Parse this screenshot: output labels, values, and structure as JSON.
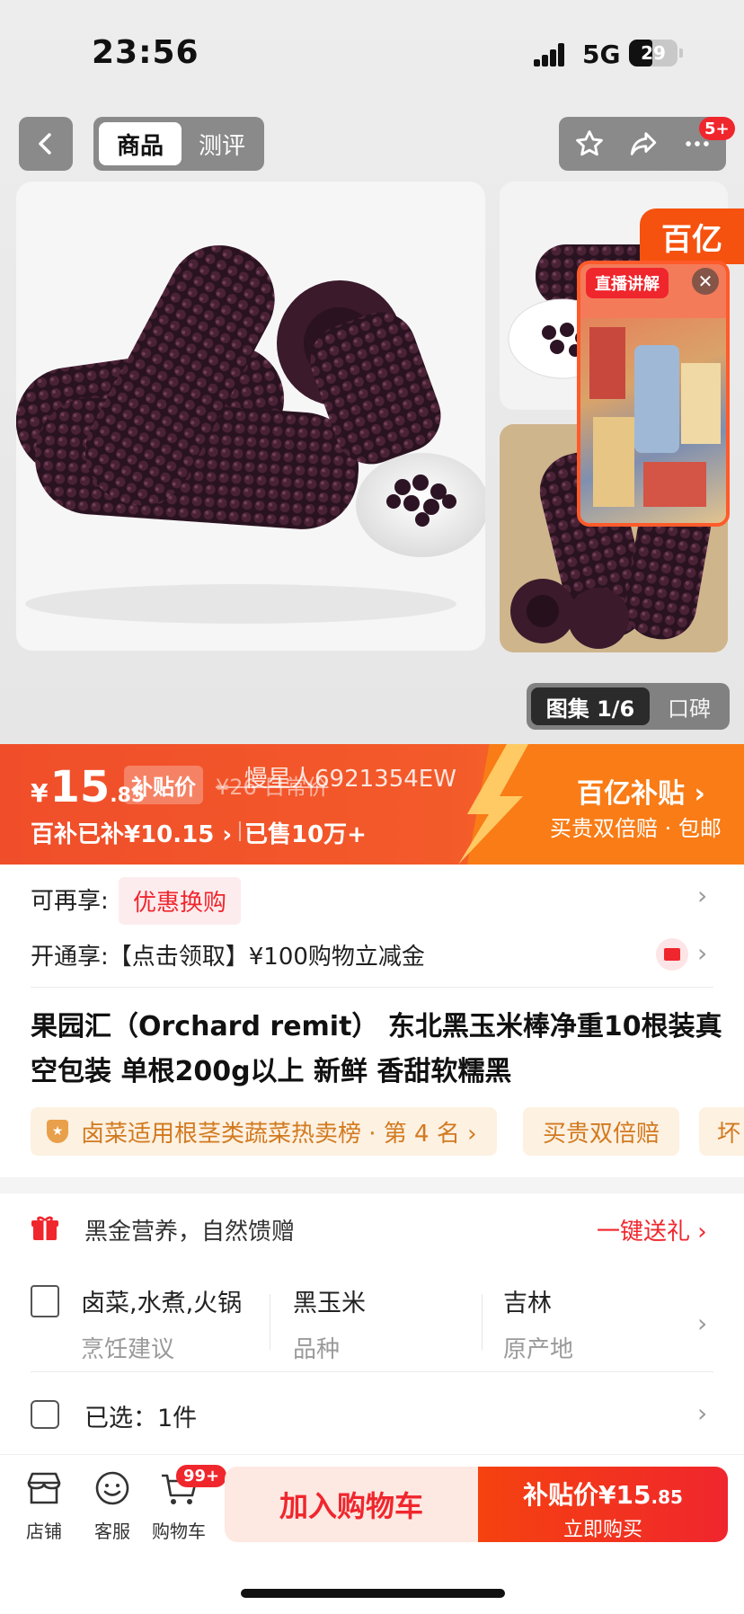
{
  "status": {
    "time": "23:56",
    "network": "5G",
    "battery": "29"
  },
  "nav": {
    "tab_active": "商品",
    "tab_other": "测评",
    "more_badge": "5+"
  },
  "gallery": {
    "brand_badge": "百亿",
    "live_label": "直播讲解",
    "close_glyph": "✕",
    "album_active": "图集 1/6",
    "album_other": "口碑"
  },
  "price": {
    "currency": "¥",
    "integer": "15",
    "decimal": ".85",
    "subsidy_tag": "补贴价",
    "original": "¥26 日常价",
    "watermark": "慢星人6921354EW",
    "subsidized": "百补已补¥10.15 ›",
    "sold": "已售10万+",
    "brand_subsidy": "百亿补贴 ›",
    "brand_note": "买贵双倍赔 · 包邮"
  },
  "offers": {
    "row1_label": "可再享:",
    "row1_tag": "优惠换购",
    "row2_label": "开通享:【点击领取】¥100购物立减金",
    "chevron": "›"
  },
  "product": {
    "title": "果园汇（Orchard remit） 东北黑玉米棒净重10根装真空包装 单根200g以上 新鲜 香甜软糯黑",
    "rank_pill": "卤菜适用根茎类蔬菜热卖榜 · 第 4 名 ›",
    "pill2": "买贵双倍赔",
    "pill3": "坏"
  },
  "gift": {
    "text": "黑金营养，自然馈赠",
    "action": "一键送礼 ›"
  },
  "specs": [
    {
      "value": "卤菜,水煮,火锅",
      "key": "烹饪建议"
    },
    {
      "value": "黑玉米",
      "key": "品种"
    },
    {
      "value": "吉林",
      "key": "原产地"
    }
  ],
  "selection": {
    "text": "已选：1件"
  },
  "bottom_bar": {
    "store": "店铺",
    "service": "客服",
    "cart": "购物车",
    "cart_badge": "99+",
    "add_to_cart": "加入购物车",
    "buy_price_label": "补贴价¥15",
    "buy_price_decimal": ".85",
    "buy_now": "立即购买"
  },
  "colors": {
    "accent": "#f0262d",
    "banner_orange": "#f97c16",
    "pill_text": "#d27a1f"
  },
  "icons": [
    "back-icon",
    "star-icon",
    "share-icon",
    "more-icon",
    "gift-icon",
    "spec-doc-icon",
    "selected-icon",
    "store-icon",
    "service-icon",
    "cart-icon",
    "card-icon"
  ]
}
